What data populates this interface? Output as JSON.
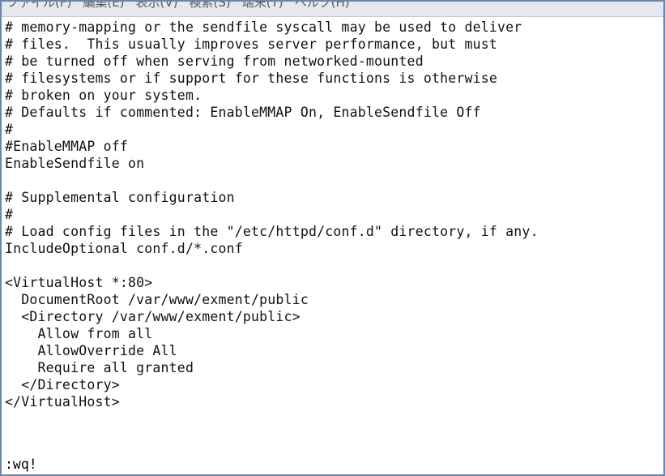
{
  "menubar": {
    "items": [
      {
        "label": "ファイル(F)"
      },
      {
        "label": "編集(E)"
      },
      {
        "label": "表示(V)"
      },
      {
        "label": "検索(S)"
      },
      {
        "label": "端末(T)"
      },
      {
        "label": "ヘルプ(H)"
      }
    ]
  },
  "editor": {
    "lines": [
      "# memory-mapping or the sendfile syscall may be used to deliver",
      "# files.  This usually improves server performance, but must",
      "# be turned off when serving from networked-mounted",
      "# filesystems or if support for these functions is otherwise",
      "# broken on your system.",
      "# Defaults if commented: EnableMMAP On, EnableSendfile Off",
      "#",
      "#EnableMMAP off",
      "EnableSendfile on",
      "",
      "# Supplemental configuration",
      "#",
      "# Load config files in the \"/etc/httpd/conf.d\" directory, if any.",
      "IncludeOptional conf.d/*.conf",
      "",
      "<VirtualHost *:80>",
      "  DocumentRoot /var/www/exment/public",
      "  <Directory /var/www/exment/public>",
      "    Allow from all",
      "    AllowOverride All",
      "    Require all granted",
      "  </Directory>",
      "</VirtualHost>",
      "",
      ""
    ]
  },
  "command_line": ":wq!"
}
